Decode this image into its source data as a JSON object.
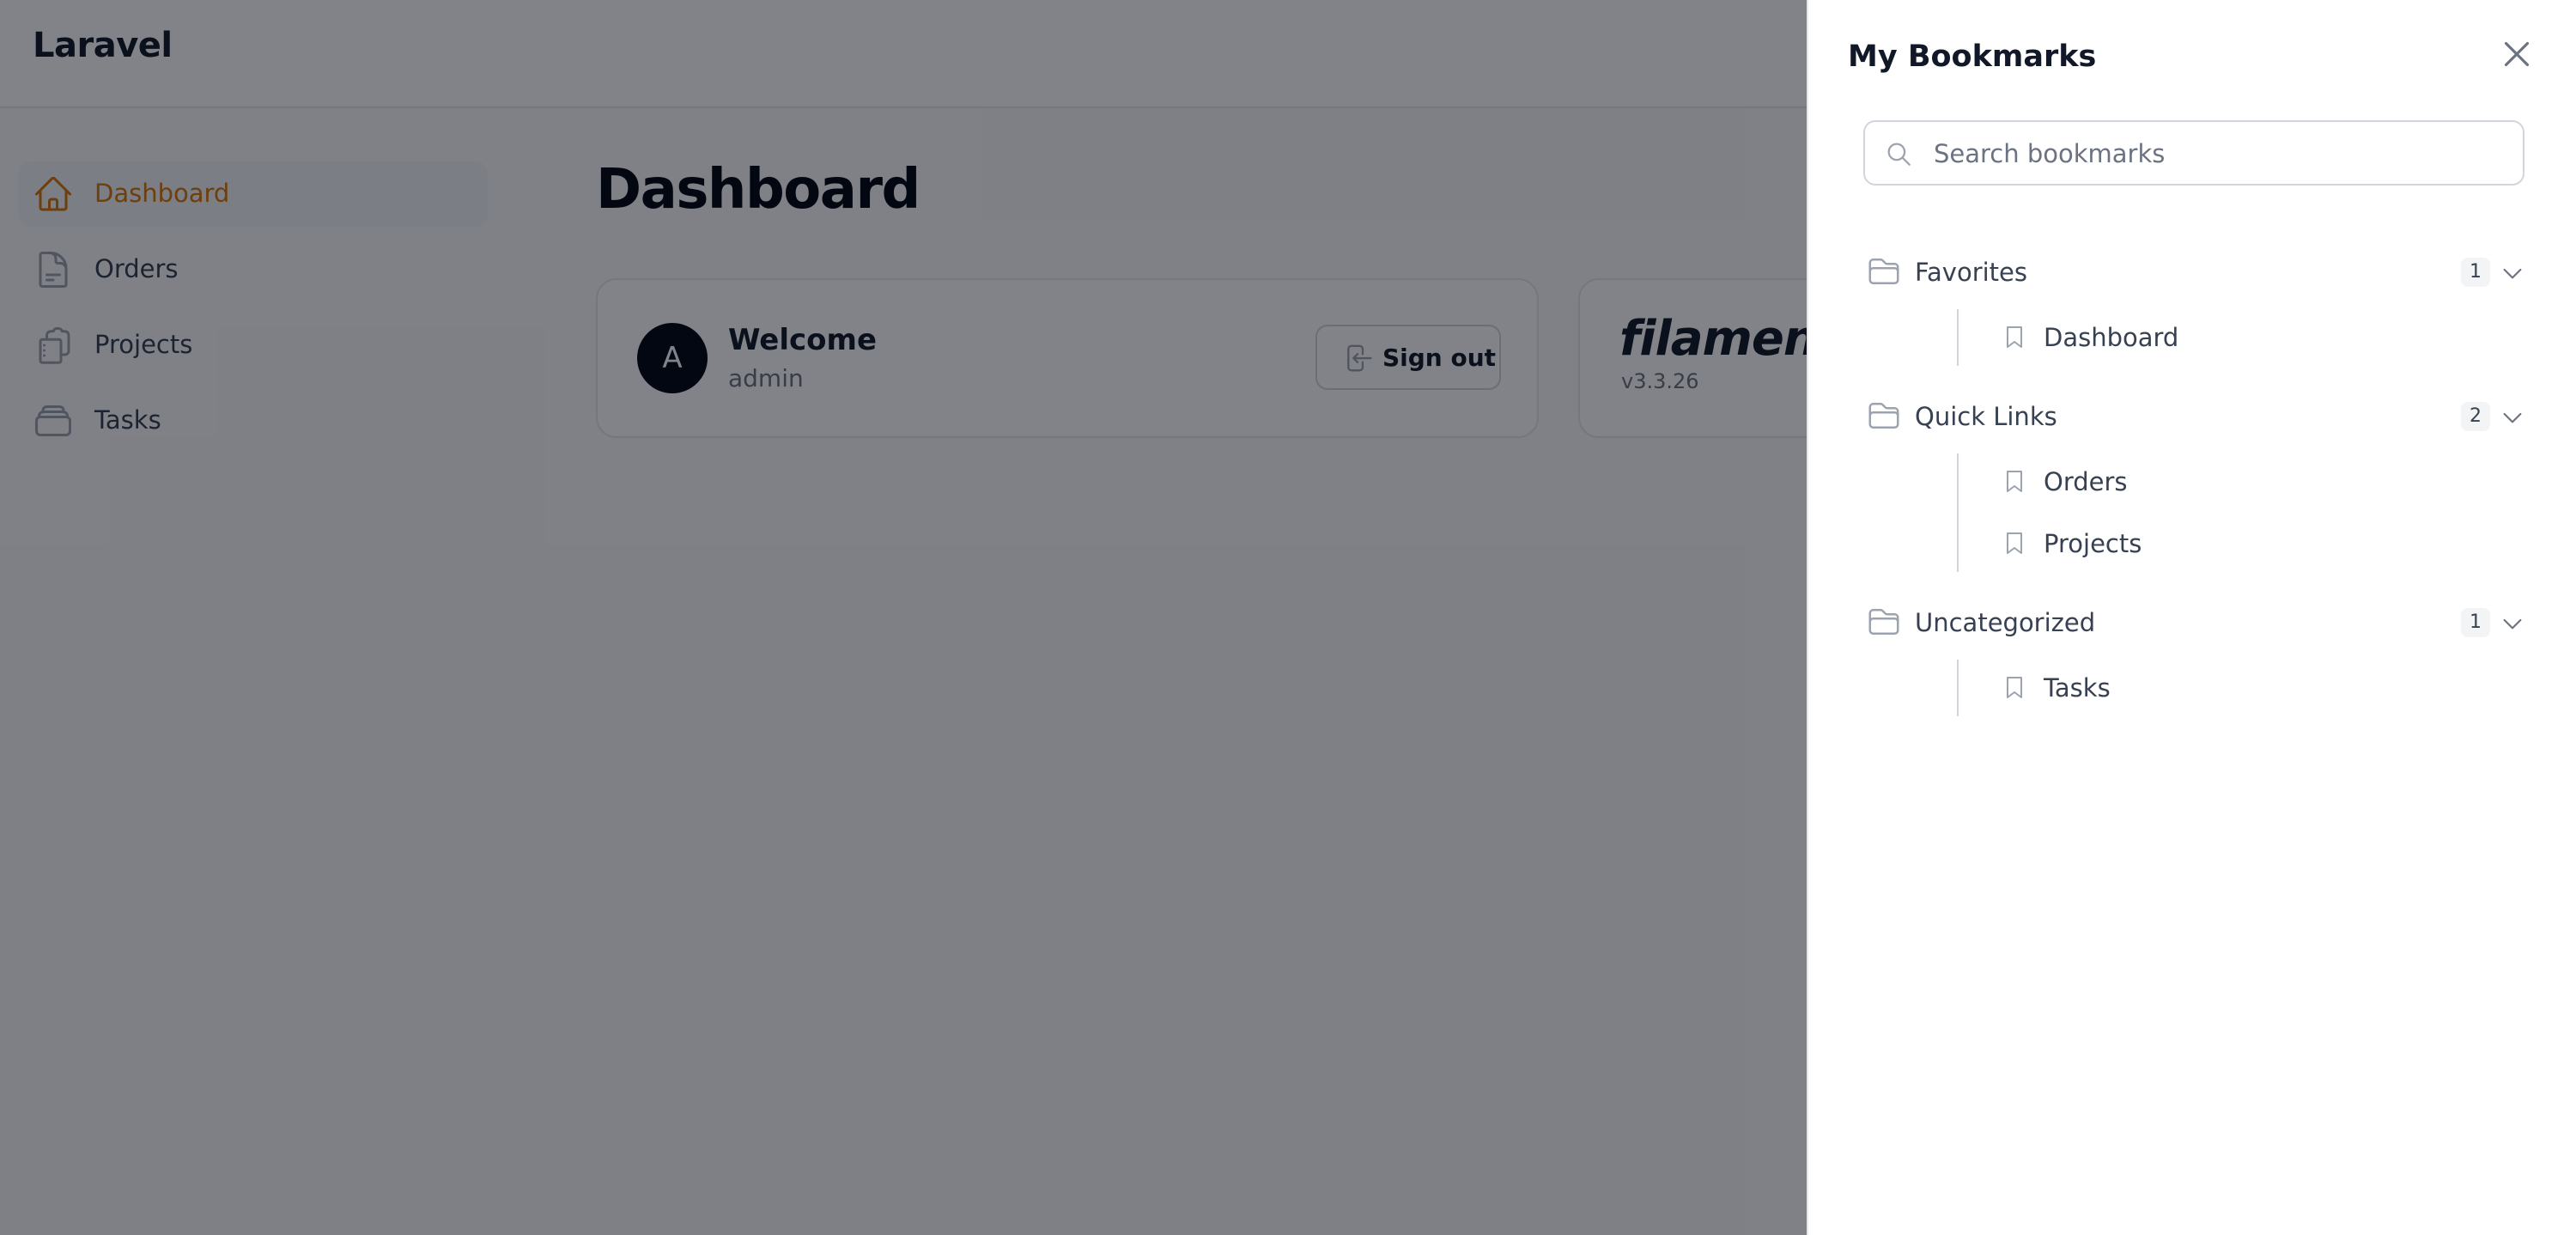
{
  "app": {
    "brand": "Laravel"
  },
  "sidebar": {
    "items": [
      {
        "label": "Dashboard",
        "icon": "home-icon",
        "active": true
      },
      {
        "label": "Orders",
        "icon": "document-icon",
        "active": false
      },
      {
        "label": "Projects",
        "icon": "clipboard-icon",
        "active": false
      },
      {
        "label": "Tasks",
        "icon": "inbox-stack-icon",
        "active": false
      }
    ]
  },
  "main": {
    "title": "Dashboard",
    "welcome_card": {
      "avatar_initial": "A",
      "title": "Welcome",
      "subtitle": "admin",
      "sign_out_label": "Sign out"
    },
    "filament_card": {
      "logo_text": "filament",
      "version": "v3.3.26"
    }
  },
  "bookmarks_drawer": {
    "title": "My Bookmarks",
    "search": {
      "placeholder": "Search bookmarks",
      "value": ""
    },
    "groups": [
      {
        "name": "Favorites",
        "count": "1",
        "items": [
          "Dashboard"
        ]
      },
      {
        "name": "Quick Links",
        "count": "2",
        "items": [
          "Orders",
          "Projects"
        ]
      },
      {
        "name": "Uncategorized",
        "count": "1",
        "items": [
          "Tasks"
        ]
      }
    ]
  },
  "colors": {
    "accent": "#d97706",
    "overlay": "#030712",
    "text": "#111827",
    "muted": "#6b7280",
    "border": "#d1d5db"
  }
}
